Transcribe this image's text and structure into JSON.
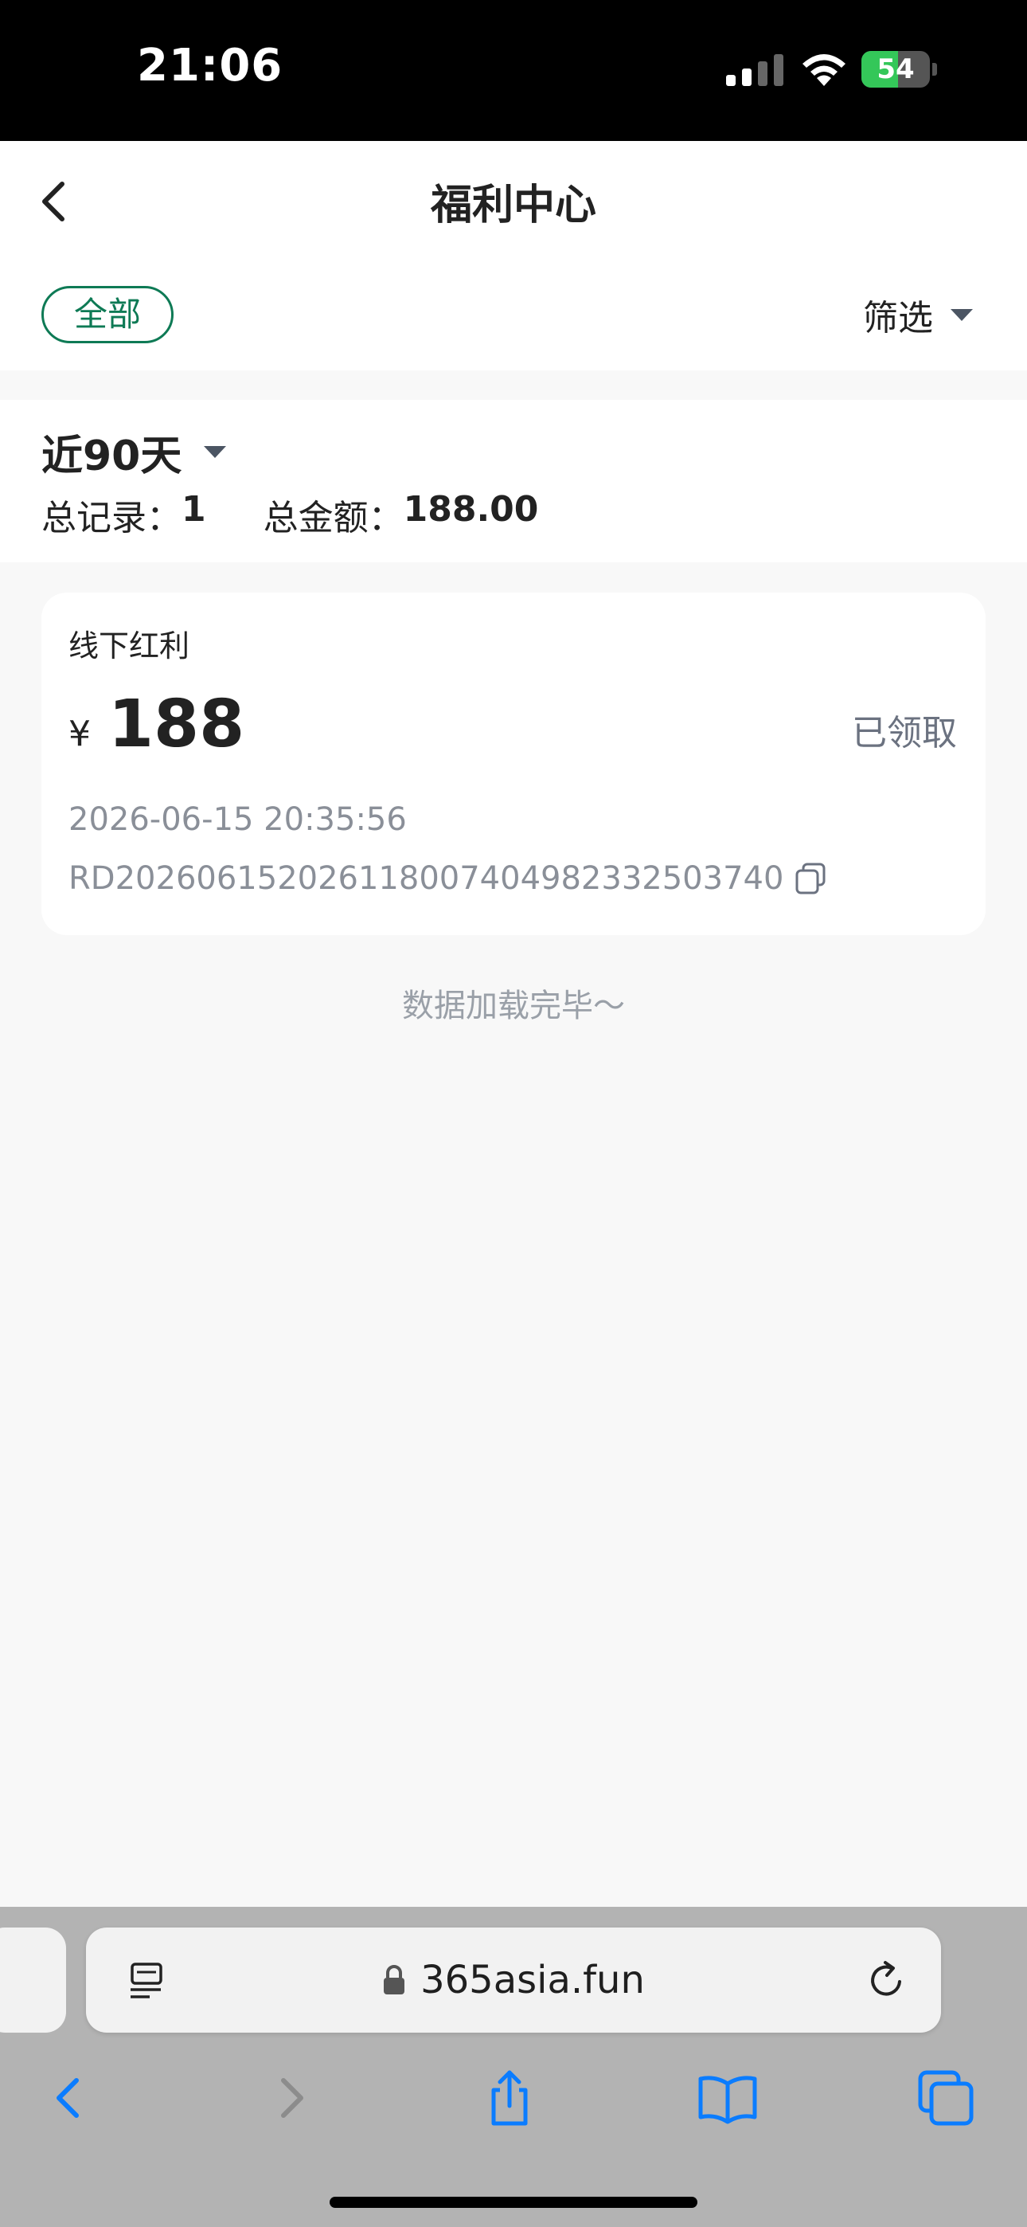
{
  "status_bar": {
    "time": "21:06",
    "battery": "54",
    "battery_level": 0.54,
    "icons": [
      "signal-icon",
      "wifi-icon",
      "battery-icon"
    ]
  },
  "nav": {
    "title": "福利中心",
    "back_icon": "chevron-left-icon"
  },
  "filter": {
    "tab_all": "全部",
    "filter_label": "筛选"
  },
  "summary": {
    "range": "近90天",
    "total_records_label": "总记录：",
    "total_records": "1",
    "total_amount_label": "总金额：",
    "total_amount": "188.00"
  },
  "records": [
    {
      "type": "线下红利",
      "currency": "¥",
      "amount": "188",
      "status": "已领取",
      "datetime": "2026-06-15 20:35:56",
      "id": "RD20260615202611800740498233250374​0"
    }
  ],
  "footer_text": "数据加载完毕～",
  "browser": {
    "url": "365asia.fun",
    "icons": [
      "reader-icon",
      "lock-icon",
      "reload-icon",
      "back-icon",
      "forward-icon",
      "share-icon",
      "bookmarks-icon",
      "tabs-icon"
    ]
  },
  "colors": {
    "accent": "#0e7a55",
    "muted": "#8a8f98",
    "ios_blue": "#0a7cff"
  }
}
